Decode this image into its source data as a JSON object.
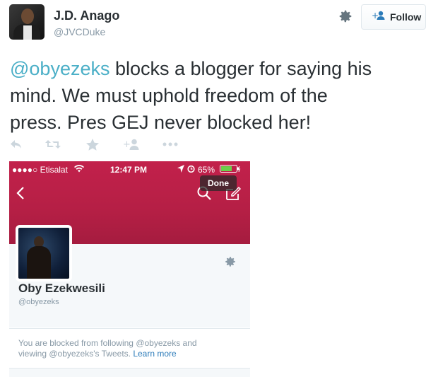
{
  "author": {
    "name": "J.D. Anago",
    "handle": "@JVCDuke"
  },
  "follow_button": {
    "label": "Follow"
  },
  "tweet": {
    "mention": "@obyezeks",
    "line1_rest": " blocks a blogger for saying his",
    "line2": "mind. We must uphold freedom of the",
    "line3": "press. Pres GEJ never blocked her!"
  },
  "actions": [
    "reply-icon",
    "retweet-icon",
    "favorite-icon",
    "follow-icon",
    "more-icon"
  ],
  "colors": {
    "mention": "#4bafc7",
    "banner": "#c2214b",
    "learn_more": "#2b7bb9",
    "text": "#292f33",
    "muted": "#8899a6"
  },
  "screenshot": {
    "carrier": "●●●●○ Etisalat",
    "time": "12:47 PM",
    "battery": "65%",
    "done_label": "Done",
    "profile_name": "Oby Ezekwesili",
    "profile_handle": "@obyezeks",
    "blocked_line1": "You are blocked from following @obyezeks and",
    "blocked_line2_prefix": "viewing @obyezeks's Tweets. ",
    "learn_more": "Learn more"
  }
}
